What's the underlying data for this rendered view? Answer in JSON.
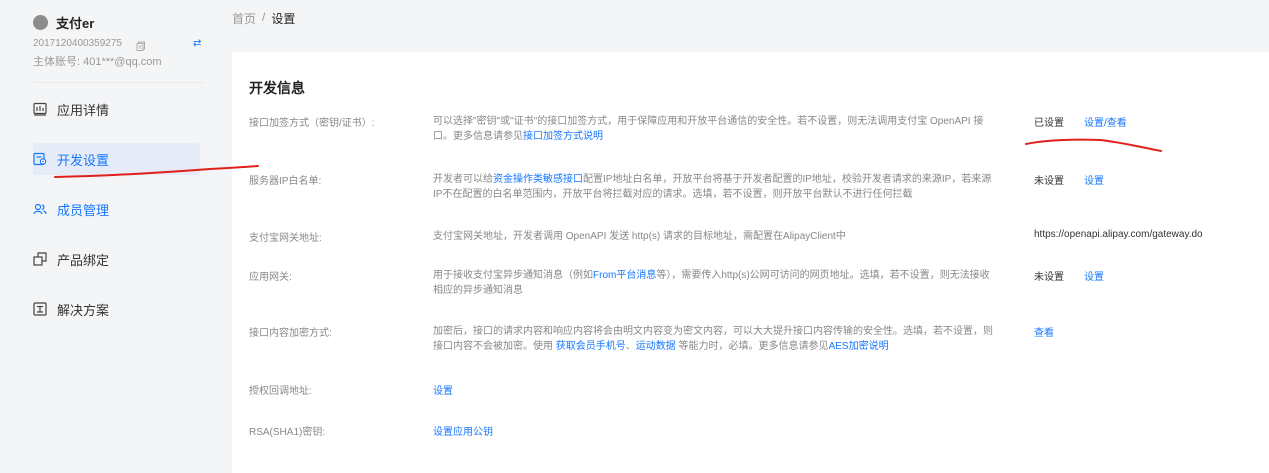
{
  "account": {
    "name": "支付er",
    "id": "2017120400359275",
    "main_account": "主体账号: 401***@qq.com"
  },
  "nav": {
    "items": [
      {
        "label": "应用详情",
        "icon": "app-detail-icon"
      },
      {
        "label": "开发设置",
        "icon": "dev-settings-icon"
      },
      {
        "label": "成员管理",
        "icon": "members-icon"
      },
      {
        "label": "产品绑定",
        "icon": "product-bind-icon"
      },
      {
        "label": "解决方案",
        "icon": "solution-icon"
      }
    ],
    "active_index": 1
  },
  "breadcrumb": {
    "home": "首页",
    "sep": "/",
    "current": "设置"
  },
  "card": {
    "title": "开发信息",
    "rows": [
      {
        "label": "接口加签方式（密钥/证书）:",
        "desc_prefix": "可以选择\"密钥\"或\"证书\"的接口加签方式，用于保障应用和开放平台通信的安全性。若不设置，则无法调用支付宝 OpenAPI 接口。更多信息请参见",
        "desc_link": "接口加签方式说明",
        "status": "已设置",
        "action": "设置/查看"
      },
      {
        "label": "服务器IP白名单:",
        "desc_prefix": "开发者可以给",
        "desc_link": "资金操作类敏感接口",
        "desc_suffix": "配置IP地址白名单，开放平台将基于开发者配置的IP地址，校验开发者请求的来源IP，若来源IP不在配置的白名单范围内，开放平台将拦截对应的请求。选填，若不设置，则开放平台默认不进行任何拦截",
        "status": "未设置",
        "action": "设置"
      },
      {
        "label": "支付宝网关地址:",
        "desc": "支付宝网关地址，开发者调用 OpenAPI 发送 http(s) 请求的目标地址，需配置在AlipayClient中",
        "status": "https://openapi.alipay.com/gateway.do"
      },
      {
        "label": "应用网关:",
        "desc_prefix": "用于接收支付宝异步通知消息（例如",
        "desc_link": "From平台消息",
        "desc_suffix": "等），需要传入http(s)公网可访问的网页地址。选填，若不设置，则无法接收相应的异步通知消息",
        "status": "未设置",
        "action": "设置"
      },
      {
        "label": "接口内容加密方式:",
        "desc_prefix": "加密后，接口的请求内容和响应内容将会由明文内容变为密文内容，可以大大提升接口内容传输的安全性。选填，若不设置，则接口内容不会被加密。使用 ",
        "desc_link": "获取会员手机号",
        "desc_mid": "、",
        "desc_link2": "运动数据",
        "desc_mid2": " 等能力时，必填。更多信息请参见",
        "desc_link3": "AES加密说明",
        "action": "查看"
      },
      {
        "label": "授权回调地址:",
        "action": "设置"
      },
      {
        "label": "RSA(SHA1)密钥:",
        "action": "设置应用公钥"
      }
    ]
  },
  "colors": {
    "accent": "#1677ff",
    "annotation": "#e0201b"
  }
}
